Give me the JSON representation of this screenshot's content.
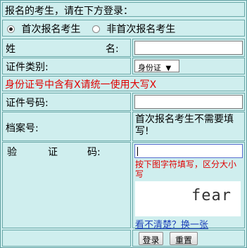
{
  "header": {
    "title": "报名的考生，请在下方登录："
  },
  "registration_type": {
    "options": [
      {
        "label": "首次报名考生",
        "checked": true
      },
      {
        "label": "非首次报名考生",
        "checked": false
      }
    ]
  },
  "fields": {
    "name_label_left": "姓",
    "name_label_right": "名:",
    "name_value": "",
    "id_type_label": "证件类别:",
    "id_type_selected": "身份证",
    "id_type_arrow": "▼",
    "id_notice": "身份证号中含有X请统一使用大写X",
    "id_number_label": "证件号码:",
    "id_number_value": "",
    "file_number_label": "档案号:",
    "file_number_note": "首次报名考生不需要填写!",
    "captcha_label_1": "验",
    "captcha_label_2": "证",
    "captcha_label_3": "码:",
    "captcha_value": "",
    "captcha_hint": "按下图字符填写，区分大小写",
    "captcha_image_text": "fear",
    "captcha_refresh_link": "看不清楚？换一张"
  },
  "buttons": {
    "login": "登录",
    "reset": "重置"
  },
  "colors": {
    "panel_bg": "#cfeeee",
    "border": "#6aa8a8",
    "notice_red": "#e00000",
    "link_blue": "#1a3eb8"
  }
}
